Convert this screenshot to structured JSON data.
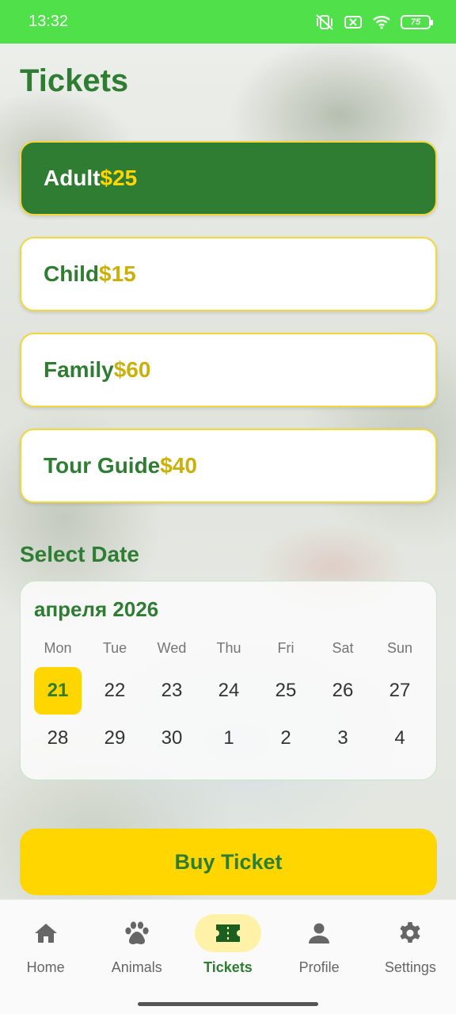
{
  "status_bar": {
    "time": "13:32",
    "battery": "75",
    "icons": [
      "vibrate-off-icon",
      "sim-off-icon",
      "wifi-icon",
      "battery-icon"
    ]
  },
  "page": {
    "title": "Tickets"
  },
  "tickets": [
    {
      "name": "Adult",
      "price": "$25",
      "selected": true
    },
    {
      "name": "Child",
      "price": "$15",
      "selected": false
    },
    {
      "name": "Family",
      "price": "$60",
      "selected": false
    },
    {
      "name": "Tour Guide",
      "price": "$40",
      "selected": false
    }
  ],
  "date_section": {
    "title": "Select Date"
  },
  "calendar": {
    "month_label": "апреля 2026",
    "weekdays": [
      "Mon",
      "Tue",
      "Wed",
      "Thu",
      "Fri",
      "Sat",
      "Sun"
    ],
    "weeks": [
      [
        "21",
        "22",
        "23",
        "24",
        "25",
        "26",
        "27"
      ],
      [
        "28",
        "29",
        "30",
        "1",
        "2",
        "3",
        "4"
      ]
    ],
    "selected_day": "21"
  },
  "buy_button": {
    "label": "Buy Ticket"
  },
  "bottom_nav": [
    {
      "label": "Home",
      "icon": "home-icon",
      "active": false
    },
    {
      "label": "Animals",
      "icon": "paw-icon",
      "active": false
    },
    {
      "label": "Tickets",
      "icon": "ticket-icon",
      "active": true
    },
    {
      "label": "Profile",
      "icon": "person-icon",
      "active": false
    },
    {
      "label": "Settings",
      "icon": "gear-icon",
      "active": false
    }
  ],
  "colors": {
    "status_bar": "#4fe04a",
    "primary_green": "#2e7d32",
    "accent_yellow": "#ffd600",
    "price_gold": "#c9b10a"
  }
}
